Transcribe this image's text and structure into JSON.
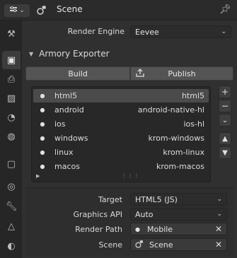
{
  "header": {
    "editor_icon": "properties-editor-icon",
    "context_icon": "scene-icon",
    "context_label": "Scene",
    "pin_icon": "pin-icon"
  },
  "tabs": [
    {
      "name": "tool-tab",
      "icon": "tool-icon"
    },
    {
      "name": "render-tab",
      "icon": "camera-back-icon",
      "active": true
    },
    {
      "name": "output-tab",
      "icon": "printer-icon"
    },
    {
      "name": "view-layer-tab",
      "icon": "image-icon"
    },
    {
      "name": "scene-tab",
      "icon": "scene-icon"
    },
    {
      "name": "world-tab",
      "icon": "world-icon"
    },
    {
      "name": "object-tab",
      "icon": "object-icon"
    },
    {
      "name": "physics-tab",
      "icon": "orbit-icon"
    },
    {
      "name": "modifier-tab",
      "icon": "wrench-icon"
    },
    {
      "name": "data-tab",
      "icon": "mesh-icon"
    },
    {
      "name": "material-tab",
      "icon": "material-icon"
    }
  ],
  "render_engine": {
    "label": "Render Engine",
    "value": "Eevee"
  },
  "exporter": {
    "title": "Armory Exporter",
    "build_label": "Build",
    "publish_label": "Publish",
    "publish_icon": "export-icon",
    "targets": [
      {
        "name": "html5",
        "value": "html5",
        "selected": true
      },
      {
        "name": "android",
        "value": "android-native-hl"
      },
      {
        "name": "ios",
        "value": "ios-hl"
      },
      {
        "name": "windows",
        "value": "krom-windows"
      },
      {
        "name": "linux",
        "value": "krom-linux"
      },
      {
        "name": "macos",
        "value": "krom-macos"
      }
    ],
    "side_buttons": [
      "+",
      "−",
      "⌄",
      "▲",
      "▼"
    ]
  },
  "properties": {
    "target_label": "Target",
    "target_value": "HTML5 (JS)",
    "graphics_label": "Graphics API",
    "graphics_value": "Auto",
    "render_path_label": "Render Path",
    "render_path_value": "Mobile",
    "scene_label": "Scene",
    "scene_value": "Scene"
  }
}
